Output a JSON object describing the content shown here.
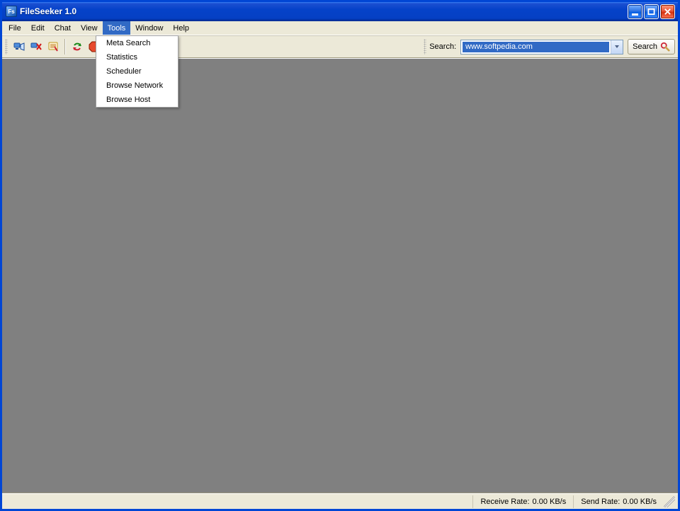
{
  "title": "FileSeeker 1.0",
  "menubar": {
    "file": "File",
    "edit": "Edit",
    "chat": "Chat",
    "view": "View",
    "tools": "Tools",
    "window": "Window",
    "help": "Help"
  },
  "tools_menu": {
    "meta_search": "Meta Search",
    "statistics": "Statistics",
    "scheduler": "Scheduler",
    "browse_network": "Browse Network",
    "browse_host": "Browse Host"
  },
  "toolbar": {
    "search_label": "Search:",
    "search_value": "www.softpedia.com",
    "search_button": "Search"
  },
  "statusbar": {
    "receive_label": "Receive Rate:",
    "receive_value": "0.00 KB/s",
    "send_label": "Send Rate:",
    "send_value": "0.00 KB/s"
  }
}
